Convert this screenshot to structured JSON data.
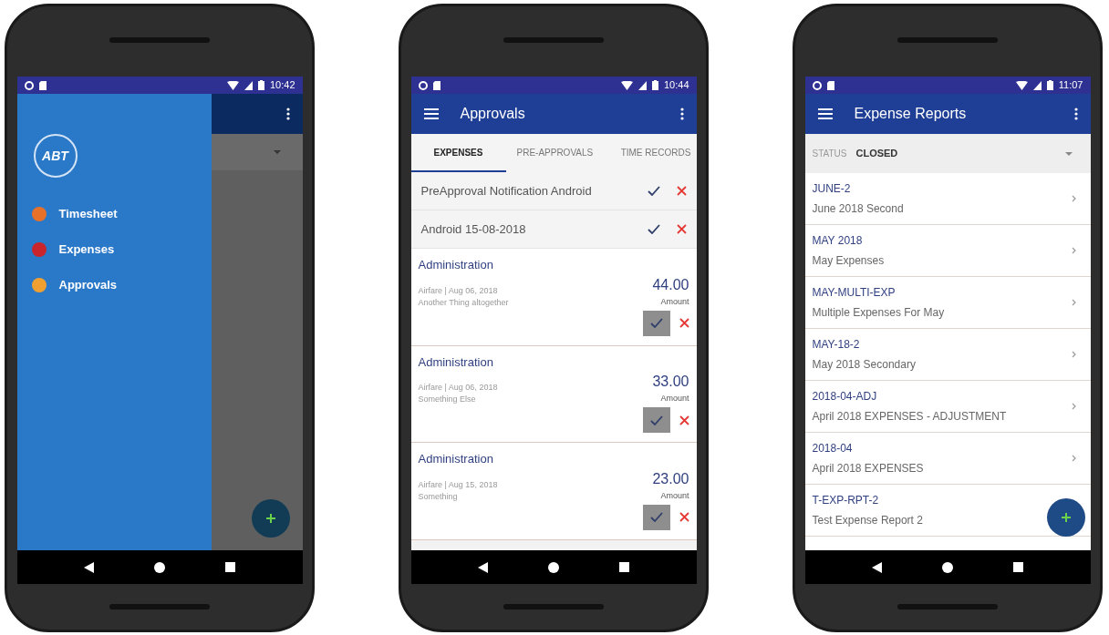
{
  "phones": [
    {
      "kind": "drawer",
      "status_bar": {
        "time": "10:42"
      },
      "drawer": {
        "logo": "ABT",
        "items": [
          {
            "label": "Timesheet",
            "color": "#e8712a"
          },
          {
            "label": "Expenses",
            "color": "#c8262c"
          },
          {
            "label": "Approvals",
            "color": "#f0a030"
          }
        ]
      }
    },
    {
      "kind": "approvals",
      "status_bar": {
        "time": "10:44"
      },
      "app_bar": {
        "title": "Approvals"
      },
      "tabs": [
        {
          "label": "EXPENSES",
          "selected": true
        },
        {
          "label": "PRE-APPROVALS",
          "selected": false
        },
        {
          "label": "TIME RECORDS",
          "selected": false
        }
      ],
      "preapprovals": [
        {
          "title": "PreApproval Notification Android"
        },
        {
          "title": "Android 15-08-2018"
        }
      ],
      "expenses": [
        {
          "category": "Administration",
          "amount": "44.00",
          "amount_label": "Amount",
          "details": [
            "Airfare | Aug 06, 2018",
            "Another Thing altogether"
          ]
        },
        {
          "category": "Administration",
          "amount": "33.00",
          "amount_label": "Amount",
          "details": [
            "Airfare | Aug 06, 2018",
            "Something Else"
          ]
        },
        {
          "category": "Administration",
          "amount": "23.00",
          "amount_label": "Amount",
          "details": [
            "Airfare | Aug 15, 2018",
            "Something"
          ]
        }
      ]
    },
    {
      "kind": "reports",
      "status_bar": {
        "time": "11:07"
      },
      "app_bar": {
        "title": "Expense Reports"
      },
      "filter": {
        "label": "STATUS",
        "value": "CLOSED"
      },
      "reports": [
        {
          "code": "JUNE-2",
          "description": "June 2018 Second"
        },
        {
          "code": "MAY 2018",
          "description": "May Expenses"
        },
        {
          "code": "MAY-MULTI-EXP",
          "description": "Multiple Expenses For May"
        },
        {
          "code": "MAY-18-2",
          "description": "May 2018 Secondary"
        },
        {
          "code": "2018-04-ADJ",
          "description": "April 2018 EXPENSES - ADJUSTMENT"
        },
        {
          "code": "2018-04",
          "description": "April 2018 EXPENSES"
        },
        {
          "code": "T-EXP-RPT-2",
          "description": "Test Expense Report 2"
        }
      ]
    }
  ]
}
